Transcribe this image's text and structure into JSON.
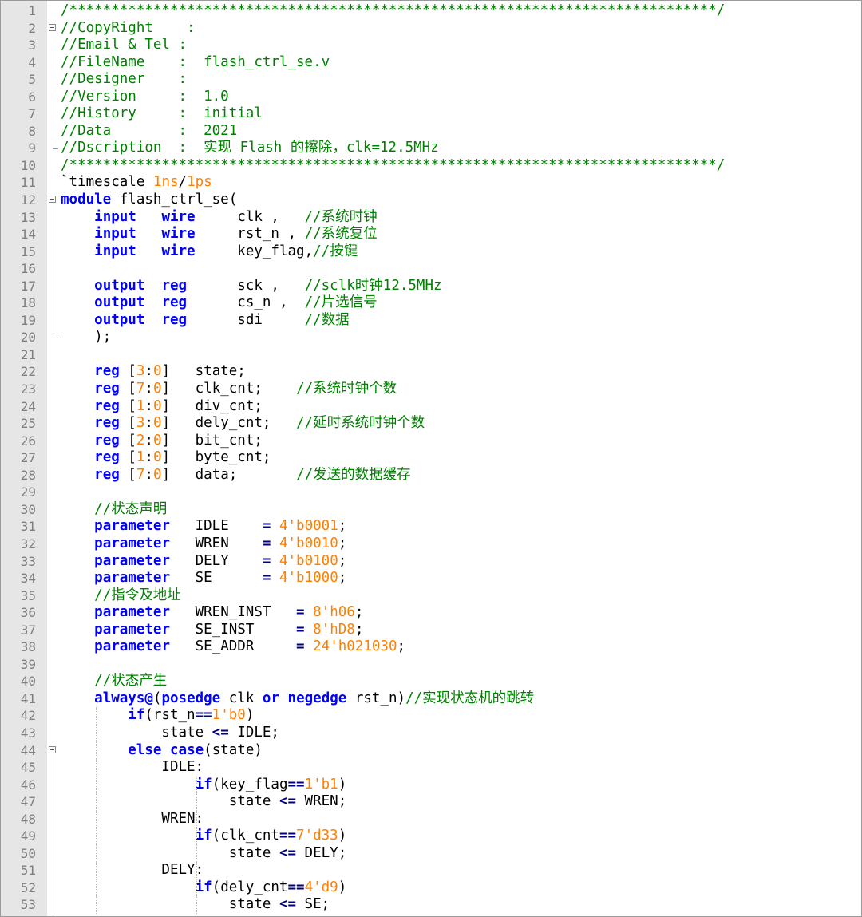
{
  "editor": {
    "colors": {
      "keyword": "#0000ff",
      "comment": "#008000",
      "number": "#ff8000",
      "operator": "#000080",
      "text": "#000000",
      "gutter": "#e6e6e6",
      "line_number": "#7e7e7e"
    },
    "fold_markers": {
      "2": "box",
      "9": "end",
      "12": "box",
      "20": "end",
      "44": "box"
    },
    "lines": [
      [
        [
          "c",
          "/*****************************************************************************/"
        ]
      ],
      [
        [
          "c",
          "//CopyRight    :"
        ]
      ],
      [
        [
          "c",
          "//Email & Tel :"
        ]
      ],
      [
        [
          "c",
          "//FileName    :  flash_ctrl_se.v"
        ]
      ],
      [
        [
          "c",
          "//Designer    :"
        ]
      ],
      [
        [
          "c",
          "//Version     :  1.0"
        ]
      ],
      [
        [
          "c",
          "//History     :  initial"
        ]
      ],
      [
        [
          "c",
          "//Data        :  2021"
        ]
      ],
      [
        [
          "c",
          "//Dscription  :  实现 Flash 的擦除，clk=12.5MHz"
        ]
      ],
      [
        [
          "c",
          "/*****************************************************************************/"
        ]
      ],
      [
        [
          "t",
          "`timescale "
        ],
        [
          "n",
          "1ns"
        ],
        [
          "t",
          "/"
        ],
        [
          "n",
          "1ps"
        ]
      ],
      [
        [
          "k",
          "module"
        ],
        [
          "t",
          " flash_ctrl_se("
        ]
      ],
      [
        [
          "t",
          "    "
        ],
        [
          "k",
          "input"
        ],
        [
          "t",
          "   "
        ],
        [
          "k",
          "wire"
        ],
        [
          "t",
          "     clk ,   "
        ],
        [
          "c",
          "//系统时钟"
        ]
      ],
      [
        [
          "t",
          "    "
        ],
        [
          "k",
          "input"
        ],
        [
          "t",
          "   "
        ],
        [
          "k",
          "wire"
        ],
        [
          "t",
          "     rst_n , "
        ],
        [
          "c",
          "//系统复位"
        ]
      ],
      [
        [
          "t",
          "    "
        ],
        [
          "k",
          "input"
        ],
        [
          "t",
          "   "
        ],
        [
          "k",
          "wire"
        ],
        [
          "t",
          "     key_flag,"
        ],
        [
          "c",
          "//按键"
        ]
      ],
      [],
      [
        [
          "t",
          "    "
        ],
        [
          "k",
          "output"
        ],
        [
          "t",
          "  "
        ],
        [
          "k",
          "reg"
        ],
        [
          "t",
          "      sck ,   "
        ],
        [
          "c",
          "//sclk时钟12.5MHz"
        ]
      ],
      [
        [
          "t",
          "    "
        ],
        [
          "k",
          "output"
        ],
        [
          "t",
          "  "
        ],
        [
          "k",
          "reg"
        ],
        [
          "t",
          "      cs_n ,  "
        ],
        [
          "c",
          "//片选信号"
        ]
      ],
      [
        [
          "t",
          "    "
        ],
        [
          "k",
          "output"
        ],
        [
          "t",
          "  "
        ],
        [
          "k",
          "reg"
        ],
        [
          "t",
          "      sdi     "
        ],
        [
          "c",
          "//数据"
        ]
      ],
      [
        [
          "t",
          "    );"
        ]
      ],
      [],
      [
        [
          "t",
          "    "
        ],
        [
          "k",
          "reg"
        ],
        [
          "t",
          " ["
        ],
        [
          "n",
          "3"
        ],
        [
          "t",
          ":"
        ],
        [
          "n",
          "0"
        ],
        [
          "t",
          "]   state;"
        ]
      ],
      [
        [
          "t",
          "    "
        ],
        [
          "k",
          "reg"
        ],
        [
          "t",
          " ["
        ],
        [
          "n",
          "7"
        ],
        [
          "t",
          ":"
        ],
        [
          "n",
          "0"
        ],
        [
          "t",
          "]   clk_cnt;    "
        ],
        [
          "c",
          "//系统时钟个数"
        ]
      ],
      [
        [
          "t",
          "    "
        ],
        [
          "k",
          "reg"
        ],
        [
          "t",
          " ["
        ],
        [
          "n",
          "1"
        ],
        [
          "t",
          ":"
        ],
        [
          "n",
          "0"
        ],
        [
          "t",
          "]   div_cnt;"
        ]
      ],
      [
        [
          "t",
          "    "
        ],
        [
          "k",
          "reg"
        ],
        [
          "t",
          " ["
        ],
        [
          "n",
          "3"
        ],
        [
          "t",
          ":"
        ],
        [
          "n",
          "0"
        ],
        [
          "t",
          "]   dely_cnt;   "
        ],
        [
          "c",
          "//延时系统时钟个数"
        ]
      ],
      [
        [
          "t",
          "    "
        ],
        [
          "k",
          "reg"
        ],
        [
          "t",
          " ["
        ],
        [
          "n",
          "2"
        ],
        [
          "t",
          ":"
        ],
        [
          "n",
          "0"
        ],
        [
          "t",
          "]   bit_cnt;"
        ]
      ],
      [
        [
          "t",
          "    "
        ],
        [
          "k",
          "reg"
        ],
        [
          "t",
          " ["
        ],
        [
          "n",
          "1"
        ],
        [
          "t",
          ":"
        ],
        [
          "n",
          "0"
        ],
        [
          "t",
          "]   byte_cnt;"
        ]
      ],
      [
        [
          "t",
          "    "
        ],
        [
          "k",
          "reg"
        ],
        [
          "t",
          " ["
        ],
        [
          "n",
          "7"
        ],
        [
          "t",
          ":"
        ],
        [
          "n",
          "0"
        ],
        [
          "t",
          "]   data;       "
        ],
        [
          "c",
          "//发送的数据缓存"
        ]
      ],
      [],
      [
        [
          "t",
          "    "
        ],
        [
          "c",
          "//状态声明"
        ]
      ],
      [
        [
          "t",
          "    "
        ],
        [
          "k",
          "parameter"
        ],
        [
          "t",
          "   IDLE    "
        ],
        [
          "o",
          "="
        ],
        [
          "t",
          " "
        ],
        [
          "n",
          "4'b0001"
        ],
        [
          "t",
          ";"
        ]
      ],
      [
        [
          "t",
          "    "
        ],
        [
          "k",
          "parameter"
        ],
        [
          "t",
          "   WREN    "
        ],
        [
          "o",
          "="
        ],
        [
          "t",
          " "
        ],
        [
          "n",
          "4'b0010"
        ],
        [
          "t",
          ";"
        ]
      ],
      [
        [
          "t",
          "    "
        ],
        [
          "k",
          "parameter"
        ],
        [
          "t",
          "   DELY    "
        ],
        [
          "o",
          "="
        ],
        [
          "t",
          " "
        ],
        [
          "n",
          "4'b0100"
        ],
        [
          "t",
          ";"
        ]
      ],
      [
        [
          "t",
          "    "
        ],
        [
          "k",
          "parameter"
        ],
        [
          "t",
          "   SE      "
        ],
        [
          "o",
          "="
        ],
        [
          "t",
          " "
        ],
        [
          "n",
          "4'b1000"
        ],
        [
          "t",
          ";"
        ]
      ],
      [
        [
          "t",
          "    "
        ],
        [
          "c",
          "//指令及地址"
        ]
      ],
      [
        [
          "t",
          "    "
        ],
        [
          "k",
          "parameter"
        ],
        [
          "t",
          "   WREN_INST   "
        ],
        [
          "o",
          "="
        ],
        [
          "t",
          " "
        ],
        [
          "n",
          "8'h06"
        ],
        [
          "t",
          ";"
        ]
      ],
      [
        [
          "t",
          "    "
        ],
        [
          "k",
          "parameter"
        ],
        [
          "t",
          "   SE_INST     "
        ],
        [
          "o",
          "="
        ],
        [
          "t",
          " "
        ],
        [
          "n",
          "8'hD8"
        ],
        [
          "t",
          ";"
        ]
      ],
      [
        [
          "t",
          "    "
        ],
        [
          "k",
          "parameter"
        ],
        [
          "t",
          "   SE_ADDR     "
        ],
        [
          "o",
          "="
        ],
        [
          "t",
          " "
        ],
        [
          "n",
          "24'h021030"
        ],
        [
          "t",
          ";"
        ]
      ],
      [],
      [
        [
          "t",
          "    "
        ],
        [
          "c",
          "//状态产生"
        ]
      ],
      [
        [
          "t",
          "    "
        ],
        [
          "k",
          "always@"
        ],
        [
          "t",
          "("
        ],
        [
          "k",
          "posedge"
        ],
        [
          "t",
          " clk "
        ],
        [
          "k",
          "or"
        ],
        [
          "t",
          " "
        ],
        [
          "k",
          "negedge"
        ],
        [
          "t",
          " rst_n)"
        ],
        [
          "c",
          "//实现状态机的跳转"
        ]
      ],
      [
        [
          "t",
          "        "
        ],
        [
          "k",
          "if"
        ],
        [
          "t",
          "(rst_n"
        ],
        [
          "o",
          "=="
        ],
        [
          "n",
          "1'b0"
        ],
        [
          "t",
          ")"
        ]
      ],
      [
        [
          "t",
          "            state "
        ],
        [
          "o",
          "<="
        ],
        [
          "t",
          " IDLE;"
        ]
      ],
      [
        [
          "t",
          "        "
        ],
        [
          "k",
          "else"
        ],
        [
          "t",
          " "
        ],
        [
          "k",
          "case"
        ],
        [
          "t",
          "(state)"
        ]
      ],
      [
        [
          "t",
          "            IDLE:"
        ]
      ],
      [
        [
          "t",
          "                "
        ],
        [
          "k",
          "if"
        ],
        [
          "t",
          "(key_flag"
        ],
        [
          "o",
          "=="
        ],
        [
          "n",
          "1'b1"
        ],
        [
          "t",
          ")"
        ]
      ],
      [
        [
          "t",
          "                    state "
        ],
        [
          "o",
          "<="
        ],
        [
          "t",
          " WREN;"
        ]
      ],
      [
        [
          "t",
          "            WREN:"
        ]
      ],
      [
        [
          "t",
          "                "
        ],
        [
          "k",
          "if"
        ],
        [
          "t",
          "(clk_cnt"
        ],
        [
          "o",
          "=="
        ],
        [
          "n",
          "7'd33"
        ],
        [
          "t",
          ")"
        ]
      ],
      [
        [
          "t",
          "                    state "
        ],
        [
          "o",
          "<="
        ],
        [
          "t",
          " DELY;"
        ]
      ],
      [
        [
          "t",
          "            DELY:"
        ]
      ],
      [
        [
          "t",
          "                "
        ],
        [
          "k",
          "if"
        ],
        [
          "t",
          "(dely_cnt"
        ],
        [
          "o",
          "=="
        ],
        [
          "n",
          "4'd9"
        ],
        [
          "t",
          ")"
        ]
      ],
      [
        [
          "t",
          "                    state "
        ],
        [
          "o",
          "<="
        ],
        [
          "t",
          " SE;"
        ]
      ]
    ]
  }
}
